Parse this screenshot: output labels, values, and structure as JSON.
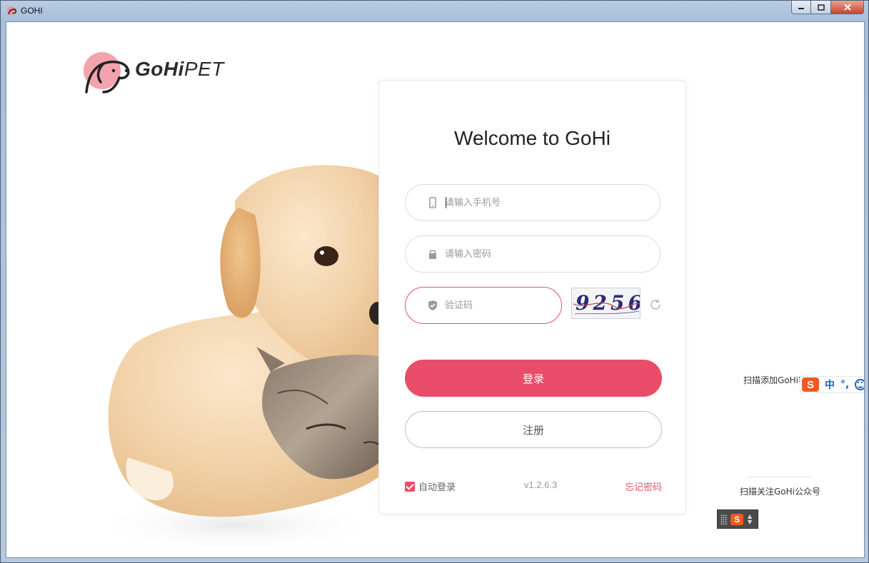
{
  "window": {
    "title": "GOHI"
  },
  "logo": {
    "bold": "GoHi",
    "light": "PET"
  },
  "login": {
    "title": "Welcome to GoHi",
    "phone_placeholder": "请输入手机号",
    "password_placeholder": "请输入密码",
    "captcha_placeholder": "验证码",
    "captcha_text": "9256",
    "login_label": "登录",
    "register_label": "注册",
    "auto_login_label": "自动登录",
    "auto_login_checked": true,
    "version": "v1.2.6.3",
    "forgot_label": "忘记密码"
  },
  "side": {
    "qr_top_label": "扫描添加GoHi客",
    "qr_bottom_label": "扫描关注GoHi公众号"
  },
  "ime": {
    "lang": "中",
    "punct": "°,"
  },
  "colors": {
    "accent": "#ea4d69",
    "ime_orange": "#f05a23",
    "ime_blue": "#1b5fbf"
  }
}
